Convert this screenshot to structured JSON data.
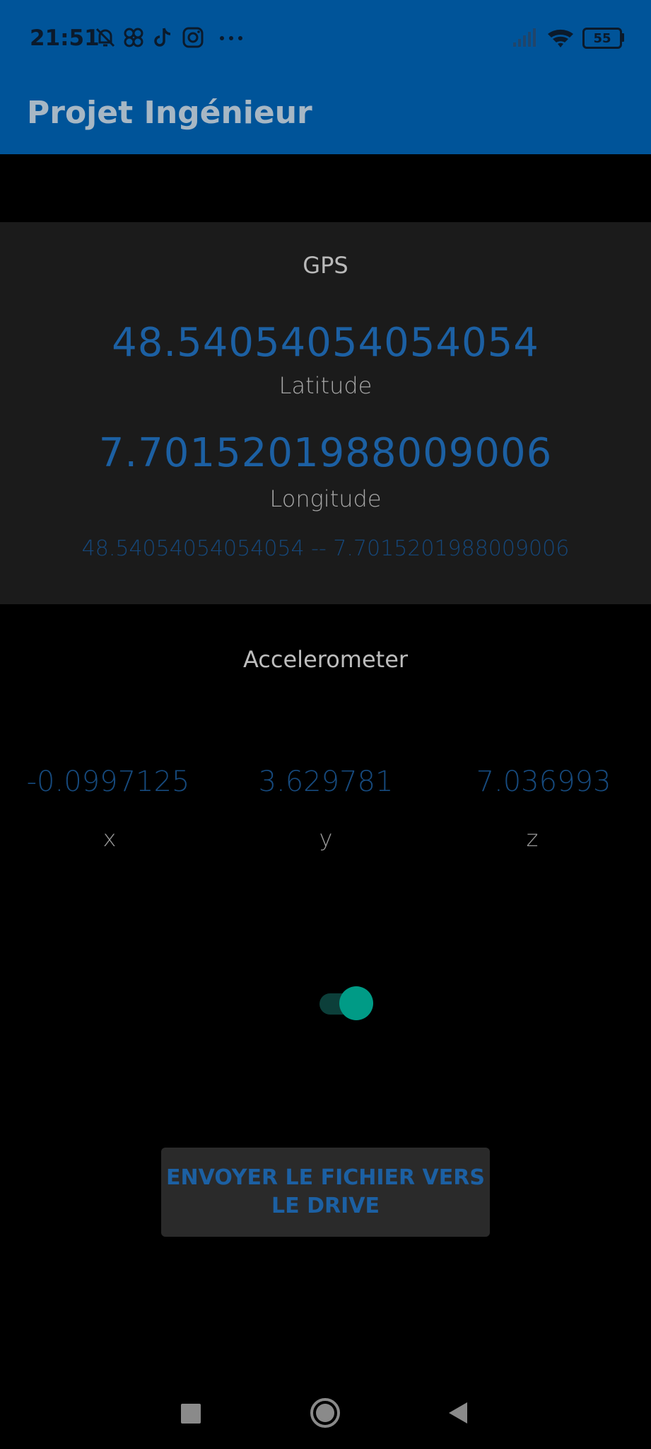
{
  "status_bar": {
    "time": "21:51",
    "battery": "55",
    "icons": [
      "bell-off-icon",
      "pinwheel-icon",
      "tiktok-icon",
      "instagram-icon",
      "more-dots-icon",
      "signal-icon",
      "wifi-icon",
      "battery-icon"
    ]
  },
  "app_bar": {
    "title": "Projet Ingénieur"
  },
  "gps": {
    "title": "GPS",
    "latitude_value": "48.54054054054054",
    "latitude_label": "Latitude",
    "longitude_value": "7.7015201988009006",
    "longitude_label": "Longitude",
    "combined": "48.54054054054054 -- 7.7015201988009006"
  },
  "accelerometer": {
    "title": "Accelerometer",
    "x_value": "-0.0997125",
    "y_value": "3.629781",
    "z_value": "7.036993",
    "x_label": "x",
    "y_label": "y",
    "z_label": "z"
  },
  "toggle": {
    "checked": true,
    "accent_color": "#009b86"
  },
  "send_button": {
    "line1": "ENVOYER LE FICHIER VERS",
    "line2": "LE DRIVE"
  },
  "nav": {
    "icons": [
      "recents-square-icon",
      "home-circle-icon",
      "back-triangle-icon"
    ]
  },
  "colors": {
    "app_bar": "#005499",
    "value_blue": "#1c60a3",
    "background": "#000000"
  }
}
